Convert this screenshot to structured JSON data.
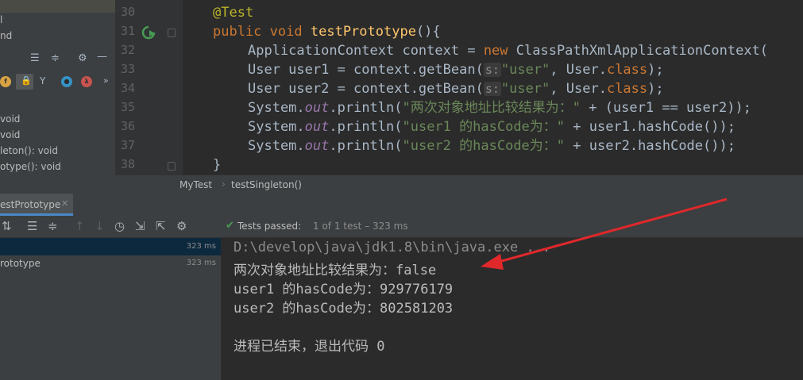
{
  "structure": {
    "top_items": [
      "l",
      "nd"
    ],
    "items": [
      {
        "label": "void"
      },
      {
        "label": "void"
      },
      {
        "label": "leton(): void"
      },
      {
        "label": "otype(): void"
      }
    ]
  },
  "editor": {
    "line_numbers": [
      "30",
      "31",
      "32",
      "33",
      "34",
      "35",
      "36",
      "37",
      "38"
    ],
    "lines": {
      "l30": {
        "annotation": "@Test"
      },
      "l31": {
        "kw1": "public",
        "kw2": "void",
        "method": "testPrototype",
        "rest": "(){"
      },
      "l32": {
        "type": "ApplicationContext context = ",
        "kw": "new",
        "rest": " ClassPathXmlApplicationContext("
      },
      "l33": {
        "pre": "User user1 = context.getBean(",
        "hint": "s:",
        "str": "\"user\"",
        "mid": ", User.",
        "kw": "class",
        "end": ");"
      },
      "l34": {
        "pre": "User user2 = context.getBean(",
        "hint": "s:",
        "str": "\"user\"",
        "mid": ", User.",
        "kw": "class",
        "end": ");"
      },
      "l35": {
        "pre": "System.",
        "field": "out",
        "call": ".println(",
        "str": "\"两次对象地址比较结果为：\"",
        "rest": " + (user1 == user2));"
      },
      "l36": {
        "pre": "System.",
        "field": "out",
        "call": ".println(",
        "str": "\"user1 的hasCode为：\"",
        "rest": " + user1.hashCode());"
      },
      "l37": {
        "pre": "System.",
        "field": "out",
        "call": ".println(",
        "str": "\"user2 的hasCode为：\"",
        "rest": " + user2.hashCode());"
      },
      "l38": {
        "brace": "}"
      }
    }
  },
  "breadcrumb": {
    "class": "MyTest",
    "method": "testSingleton()"
  },
  "run": {
    "tab_label": "estPrototype",
    "status_label": "Tests passed:",
    "status_detail": "1 of 1 test – 323 ms",
    "tree": [
      {
        "name": "",
        "time": "323 ms"
      },
      {
        "name": "rototype",
        "time": "323 ms"
      }
    ]
  },
  "console": {
    "lines": [
      "D:\\develop\\java\\jdk1.8\\bin\\java.exe ...",
      "两次对象地址比较结果为：false",
      "user1 的hasCode为：929776179",
      "user2 的hasCode为：802581203",
      "",
      "进程已结束，退出代码 0"
    ]
  },
  "colors": {
    "arrow": "#e0282b",
    "pass": "#499c54",
    "keyword": "#cc7832",
    "string": "#6a8759"
  }
}
